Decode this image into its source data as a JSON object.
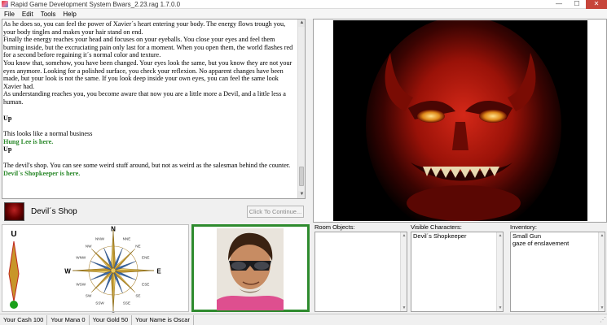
{
  "window": {
    "title": "Rapid Game Development System Bwars_2.23.rag 1.7.0.0",
    "minimize": "—",
    "maximize": "☐",
    "close": "✕"
  },
  "menu": [
    "File",
    "Edit",
    "Tools",
    "Help"
  ],
  "story": {
    "paragraphs": [
      {
        "style": "normal",
        "text": "As he does so, you can feel the power of Xavier´s heart entering your body. The energy flows trough you, your body tingles and makes your hair stand on end."
      },
      {
        "style": "normal",
        "text": "Finally the energy reaches your head and focuses on your eyeballs. You close your eyes and feel them burning inside, but the excruciating pain only last for a moment. When you open them, the world flashes red for a second before regaining it´s normal color and texture."
      },
      {
        "style": "normal",
        "text": "You know that, somehow, you have been changed. Your eyes look the same, but you know they are not your eyes anymore. Looking for a polished surface, you check your reflexion. No apparent changes have been made, but your look is not the same. If you look deep inside your own eyes, you can feel the same look Xavier had."
      },
      {
        "style": "normal",
        "text": "As understanding reaches you, you become aware that now you are a little more a Devil, and a little less a human."
      },
      {
        "style": "gap",
        "text": ""
      },
      {
        "style": "bold",
        "text": "Up"
      },
      {
        "style": "gap",
        "text": ""
      },
      {
        "style": "normal",
        "text": "This looks like a normal business"
      },
      {
        "style": "green",
        "text": "Hung Lee is here."
      },
      {
        "style": "bold",
        "text": "Up"
      },
      {
        "style": "gap",
        "text": ""
      },
      {
        "style": "normal",
        "text": "The devil's shop. You can see some weird stuff around, but not as weird as the salesman behind the counter."
      },
      {
        "style": "green",
        "text": "Devil´s Shopkeeper is here."
      }
    ]
  },
  "location": {
    "name": "Devil´s Shop",
    "continue_label": "Click To Continue..."
  },
  "gauge": {
    "top_label": "U",
    "colors": {
      "fill": "#c8962a",
      "stroke": "#c0281e",
      "dot": "#1aa01a"
    }
  },
  "compass": {
    "labels": [
      "N",
      "NNE",
      "NE",
      "ENE",
      "E",
      "ESE",
      "SE",
      "SSE",
      "S",
      "SSW",
      "SW",
      "WSW",
      "W",
      "WNW",
      "NW",
      "NNW"
    ]
  },
  "panels": {
    "room_objects": {
      "label": "Room Objects:",
      "items": []
    },
    "visible_characters": {
      "label": "Visible Characters:",
      "items": [
        "Devil´s Shopkeeper"
      ]
    },
    "inventory": {
      "label": "Inventory:",
      "items": [
        "Small Gun",
        "gaze of enslavement"
      ]
    }
  },
  "status": {
    "cash": "Your Cash 100",
    "mana": "Your Mana 0",
    "gold": "Your Gold 50",
    "name": "Your Name is Oscar"
  },
  "colors": {
    "story_green": "#2d8a2d",
    "npc_border": "#2e8b2e",
    "close_button": "#c7453b"
  }
}
